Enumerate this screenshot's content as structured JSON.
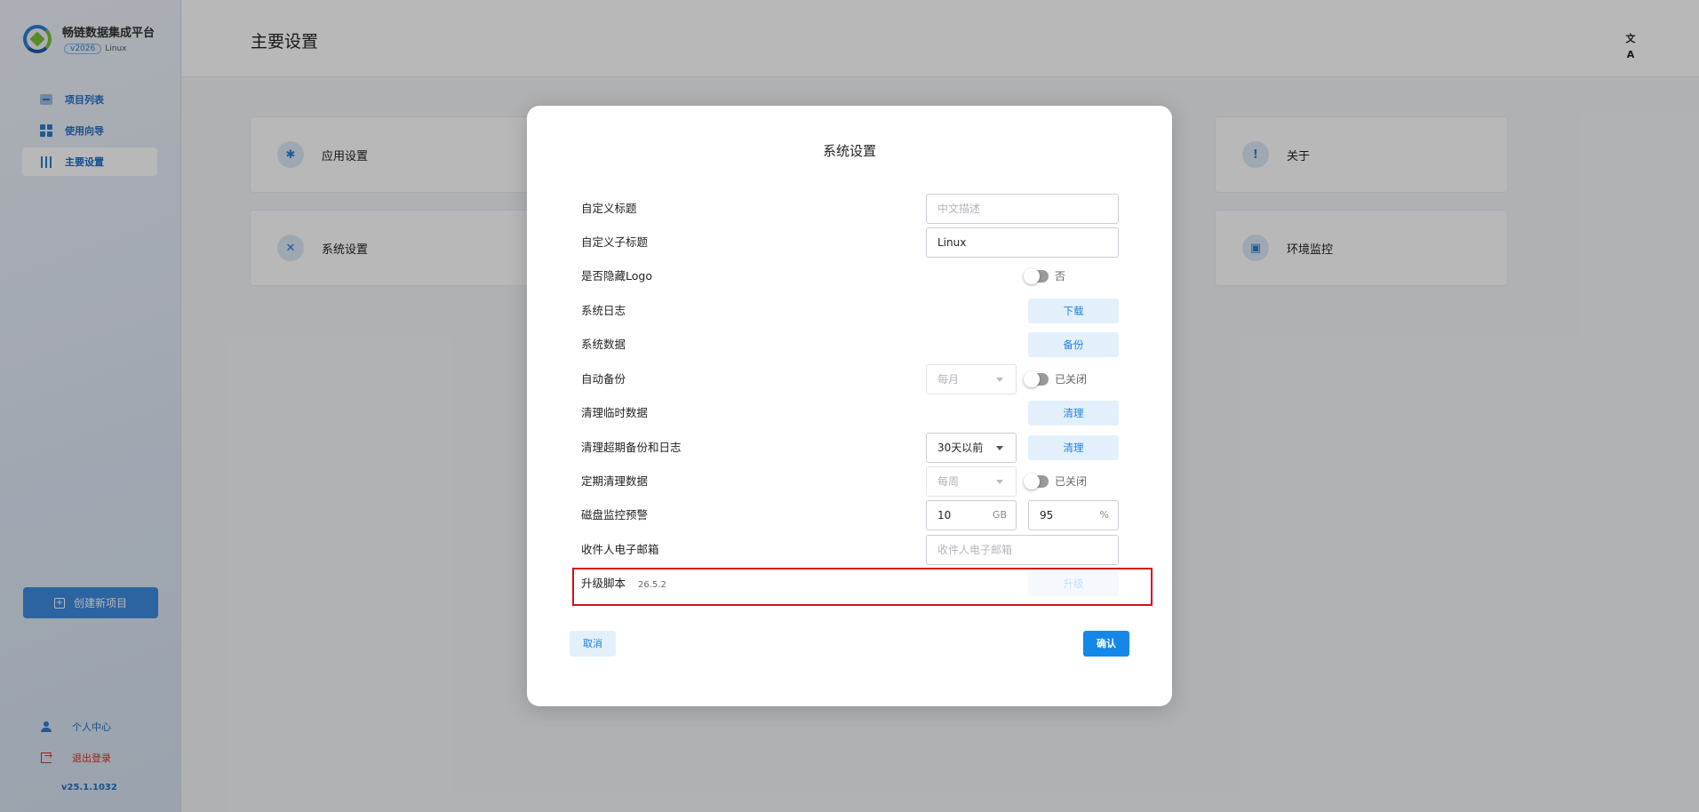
{
  "sidebar": {
    "app_name": "畅链数据集成平台",
    "version_badge": "v2026",
    "os_label": "Linux",
    "nav": [
      {
        "label": "项目列表",
        "icon": "project-list-icon"
      },
      {
        "label": "使用向导",
        "icon": "grid-icon"
      },
      {
        "label": "主要设置",
        "icon": "sliders-icon",
        "active": true
      }
    ],
    "create_button": "创建新项目",
    "personal_center": "个人中心",
    "logout": "退出登录",
    "version": "v25.1.1032"
  },
  "header": {
    "title": "主要设置",
    "translate_icon": "文A"
  },
  "cards": [
    {
      "label": "应用设置",
      "icon": "gear-icon",
      "glyph": "✱"
    },
    {
      "label": "关于",
      "icon": "info-icon",
      "glyph": "!"
    },
    {
      "label": "系统设置",
      "icon": "tools-icon",
      "glyph": "✕"
    },
    {
      "label": "环境监控",
      "icon": "monitor-icon",
      "glyph": "▣"
    }
  ],
  "modal": {
    "title": "系统设置",
    "custom_title": {
      "label": "自定义标题",
      "placeholder": "中文描述"
    },
    "custom_subtitle": {
      "label": "自定义子标题",
      "value": "Linux"
    },
    "hide_logo": {
      "label": "是否隐藏Logo",
      "state": "否"
    },
    "system_log": {
      "label": "系统日志",
      "button": "下载"
    },
    "system_data": {
      "label": "系统数据",
      "button": "备份"
    },
    "auto_backup": {
      "label": "自动备份",
      "select": "每月",
      "state": "已关闭"
    },
    "clean_temp": {
      "label": "清理临时数据",
      "button": "清理"
    },
    "clean_expired": {
      "label": "清理超期备份和日志",
      "select": "30天以前",
      "button": "清理"
    },
    "scheduled_clean": {
      "label": "定期清理数据",
      "select": "每周",
      "state": "已关闭"
    },
    "disk_alert": {
      "label": "磁盘监控预警",
      "gb_value": "10",
      "gb_unit": "GB",
      "pct_value": "95",
      "pct_unit": "%"
    },
    "recipient_email": {
      "label": "收件人电子邮箱",
      "placeholder": "收件人电子邮箱"
    },
    "upgrade_script": {
      "label": "升级脚本",
      "version": "26.5.2",
      "button": "升级"
    },
    "cancel": "取消",
    "confirm": "确认"
  },
  "colors": {
    "accent": "#1488e8",
    "highlight_border": "#d4101c",
    "logout_red": "#d93025"
  }
}
